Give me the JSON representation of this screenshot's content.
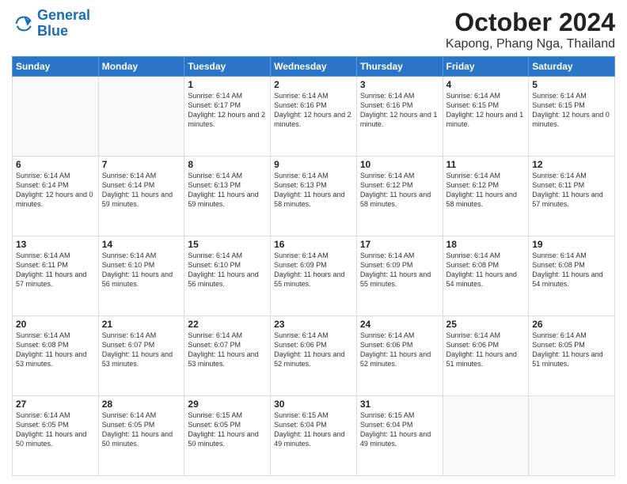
{
  "header": {
    "logo_line1": "General",
    "logo_line2": "Blue",
    "title": "October 2024",
    "subtitle": "Kapong, Phang Nga, Thailand"
  },
  "days_of_week": [
    "Sunday",
    "Monday",
    "Tuesday",
    "Wednesday",
    "Thursday",
    "Friday",
    "Saturday"
  ],
  "weeks": [
    [
      {
        "day": "",
        "info": ""
      },
      {
        "day": "",
        "info": ""
      },
      {
        "day": "1",
        "info": "Sunrise: 6:14 AM\nSunset: 6:17 PM\nDaylight: 12 hours\nand 2 minutes."
      },
      {
        "day": "2",
        "info": "Sunrise: 6:14 AM\nSunset: 6:16 PM\nDaylight: 12 hours\nand 2 minutes."
      },
      {
        "day": "3",
        "info": "Sunrise: 6:14 AM\nSunset: 6:16 PM\nDaylight: 12 hours\nand 1 minute."
      },
      {
        "day": "4",
        "info": "Sunrise: 6:14 AM\nSunset: 6:15 PM\nDaylight: 12 hours\nand 1 minute."
      },
      {
        "day": "5",
        "info": "Sunrise: 6:14 AM\nSunset: 6:15 PM\nDaylight: 12 hours\nand 0 minutes."
      }
    ],
    [
      {
        "day": "6",
        "info": "Sunrise: 6:14 AM\nSunset: 6:14 PM\nDaylight: 12 hours\nand 0 minutes."
      },
      {
        "day": "7",
        "info": "Sunrise: 6:14 AM\nSunset: 6:14 PM\nDaylight: 11 hours\nand 59 minutes."
      },
      {
        "day": "8",
        "info": "Sunrise: 6:14 AM\nSunset: 6:13 PM\nDaylight: 11 hours\nand 59 minutes."
      },
      {
        "day": "9",
        "info": "Sunrise: 6:14 AM\nSunset: 6:13 PM\nDaylight: 11 hours\nand 58 minutes."
      },
      {
        "day": "10",
        "info": "Sunrise: 6:14 AM\nSunset: 6:12 PM\nDaylight: 11 hours\nand 58 minutes."
      },
      {
        "day": "11",
        "info": "Sunrise: 6:14 AM\nSunset: 6:12 PM\nDaylight: 11 hours\nand 58 minutes."
      },
      {
        "day": "12",
        "info": "Sunrise: 6:14 AM\nSunset: 6:11 PM\nDaylight: 11 hours\nand 57 minutes."
      }
    ],
    [
      {
        "day": "13",
        "info": "Sunrise: 6:14 AM\nSunset: 6:11 PM\nDaylight: 11 hours\nand 57 minutes."
      },
      {
        "day": "14",
        "info": "Sunrise: 6:14 AM\nSunset: 6:10 PM\nDaylight: 11 hours\nand 56 minutes."
      },
      {
        "day": "15",
        "info": "Sunrise: 6:14 AM\nSunset: 6:10 PM\nDaylight: 11 hours\nand 56 minutes."
      },
      {
        "day": "16",
        "info": "Sunrise: 6:14 AM\nSunset: 6:09 PM\nDaylight: 11 hours\nand 55 minutes."
      },
      {
        "day": "17",
        "info": "Sunrise: 6:14 AM\nSunset: 6:09 PM\nDaylight: 11 hours\nand 55 minutes."
      },
      {
        "day": "18",
        "info": "Sunrise: 6:14 AM\nSunset: 6:08 PM\nDaylight: 11 hours\nand 54 minutes."
      },
      {
        "day": "19",
        "info": "Sunrise: 6:14 AM\nSunset: 6:08 PM\nDaylight: 11 hours\nand 54 minutes."
      }
    ],
    [
      {
        "day": "20",
        "info": "Sunrise: 6:14 AM\nSunset: 6:08 PM\nDaylight: 11 hours\nand 53 minutes."
      },
      {
        "day": "21",
        "info": "Sunrise: 6:14 AM\nSunset: 6:07 PM\nDaylight: 11 hours\nand 53 minutes."
      },
      {
        "day": "22",
        "info": "Sunrise: 6:14 AM\nSunset: 6:07 PM\nDaylight: 11 hours\nand 53 minutes."
      },
      {
        "day": "23",
        "info": "Sunrise: 6:14 AM\nSunset: 6:06 PM\nDaylight: 11 hours\nand 52 minutes."
      },
      {
        "day": "24",
        "info": "Sunrise: 6:14 AM\nSunset: 6:06 PM\nDaylight: 11 hours\nand 52 minutes."
      },
      {
        "day": "25",
        "info": "Sunrise: 6:14 AM\nSunset: 6:06 PM\nDaylight: 11 hours\nand 51 minutes."
      },
      {
        "day": "26",
        "info": "Sunrise: 6:14 AM\nSunset: 6:05 PM\nDaylight: 11 hours\nand 51 minutes."
      }
    ],
    [
      {
        "day": "27",
        "info": "Sunrise: 6:14 AM\nSunset: 6:05 PM\nDaylight: 11 hours\nand 50 minutes."
      },
      {
        "day": "28",
        "info": "Sunrise: 6:14 AM\nSunset: 6:05 PM\nDaylight: 11 hours\nand 50 minutes."
      },
      {
        "day": "29",
        "info": "Sunrise: 6:15 AM\nSunset: 6:05 PM\nDaylight: 11 hours\nand 50 minutes."
      },
      {
        "day": "30",
        "info": "Sunrise: 6:15 AM\nSunset: 6:04 PM\nDaylight: 11 hours\nand 49 minutes."
      },
      {
        "day": "31",
        "info": "Sunrise: 6:15 AM\nSunset: 6:04 PM\nDaylight: 11 hours\nand 49 minutes."
      },
      {
        "day": "",
        "info": ""
      },
      {
        "day": "",
        "info": ""
      }
    ]
  ]
}
